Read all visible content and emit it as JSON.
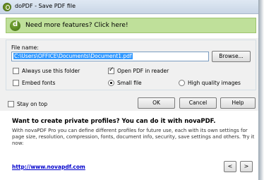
{
  "window": {
    "title": "doPDF - Save PDF file"
  },
  "banner": {
    "text": "Need more features? Click here!"
  },
  "file": {
    "label": "File name:",
    "value": "C:\\Users\\OFFICE\\Documents\\Document1.pdf",
    "browse_label": "Browse..."
  },
  "options": {
    "always_use_folder": "Always use this folder",
    "open_pdf": "Open PDF in reader",
    "embed_fonts": "Embed fonts",
    "small_file": "Small file",
    "high_quality": "High quality images",
    "stay_on_top": "Stay on top"
  },
  "buttons": {
    "ok": "OK",
    "cancel": "Cancel",
    "help": "Help",
    "prev": "<",
    "next": ">"
  },
  "promo": {
    "title": "Want to create private profiles? You can do it with novaPDF.",
    "body": "With novaPDF Pro you can define different profiles for future use, each with its own settings for page size, resolution, compression, fonts, document info, security, save settings and others. Try it now:",
    "link": "http://www.novapdf.com"
  }
}
